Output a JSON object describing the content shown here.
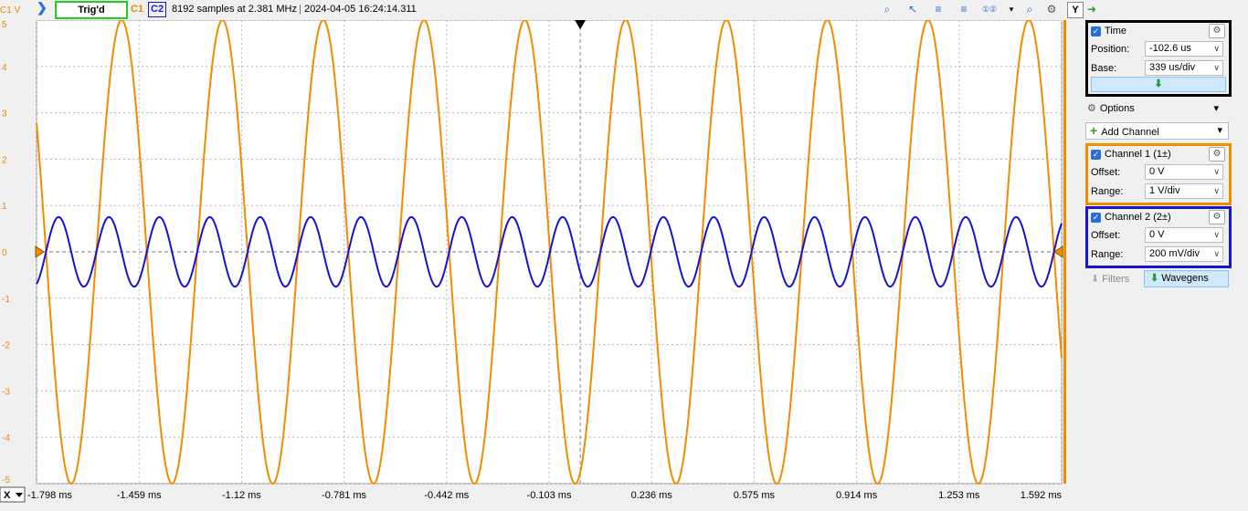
{
  "toolbar": {
    "trigger_status": "Trig'd",
    "c1_label": "C1",
    "c2_label": "C2",
    "sample_info": "8192 samples at 2.381 MHz",
    "separator": "|",
    "timestamp": "2024-04-05 16:24:14.311",
    "y_button": "Y",
    "y_unit_label": "C1 V"
  },
  "chart_data": {
    "type": "line",
    "xlabel": "",
    "x_unit": "ms",
    "xlim": [
      -1.798,
      1.592
    ],
    "x_tick_labels": [
      "-1.798 ms",
      "-1.459 ms",
      "-1.12 ms",
      "-0.781 ms",
      "-0.442 ms",
      "-0.103 ms",
      "0.236 ms",
      "0.575 ms",
      "0.914 ms",
      "1.253 ms",
      "1.592 ms"
    ],
    "x_ticks": [
      -1.798,
      -1.459,
      -1.12,
      -0.781,
      -0.442,
      -0.103,
      0.236,
      0.575,
      0.914,
      1.253,
      1.592
    ],
    "ylabel": "C1 V",
    "ylim": [
      -5,
      5
    ],
    "y_ticks": [
      5,
      4,
      3,
      2,
      1,
      0,
      -1,
      -2,
      -3,
      -4,
      -5
    ],
    "y_tick_labels": [
      "5",
      "4",
      "3",
      "2",
      "1",
      "0",
      "-1",
      "-2",
      "-3",
      "-4",
      "-5"
    ],
    "grid": true,
    "trigger_time_ms": 0,
    "series": [
      {
        "channel": "C1",
        "color": "#f08c00",
        "waveform": "sine",
        "amplitude_v": 5.0,
        "frequency_hz": 3000,
        "phase_ref_ms": -1.6,
        "unit": "V"
      },
      {
        "channel": "C2",
        "color": "#1414d2",
        "waveform": "sine",
        "amplitude_v": 0.75,
        "frequency_hz": 6000,
        "phase_ref_ms": -1.6,
        "unit": "V",
        "y_scale": "200 mV/div"
      }
    ]
  },
  "panel": {
    "time": {
      "title": "Time",
      "position_label": "Position:",
      "position_value": "-102.6 us",
      "base_label": "Base:",
      "base_value": "339 us/div"
    },
    "options_label": "Options",
    "add_channel_label": "Add Channel",
    "channel1": {
      "title": "Channel 1 (1±)",
      "offset_label": "Offset:",
      "offset_value": "0 V",
      "range_label": "Range:",
      "range_value": "1 V/div"
    },
    "channel2": {
      "title": "Channel 2 (2±)",
      "offset_label": "Offset:",
      "offset_value": "0 V",
      "range_label": "Range:",
      "range_value": "200 mV/div"
    },
    "filters_label": "Filters",
    "wavegens_label": "Wavegens"
  },
  "colors": {
    "c1": "#f08c00",
    "c2": "#1414d2",
    "trig_border": "#1fcf1f",
    "accent": "#2a6fd6"
  }
}
